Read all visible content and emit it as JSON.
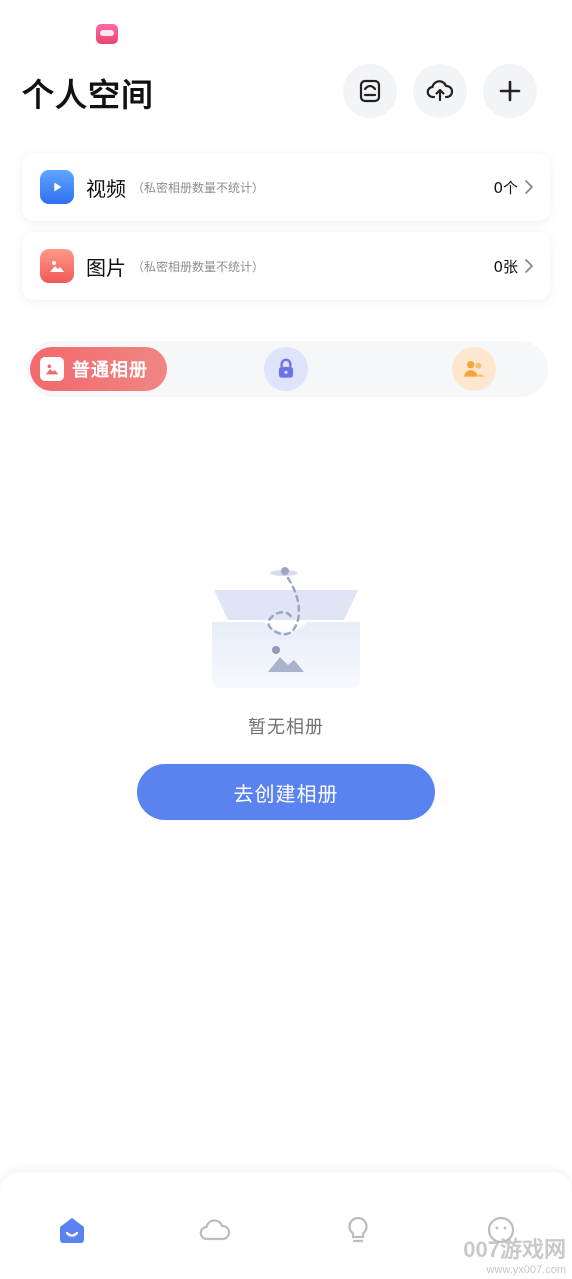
{
  "header": {
    "title": "个人空间"
  },
  "stats": [
    {
      "title": "视频",
      "note": "（私密相册数量不统计）",
      "count": "0个"
    },
    {
      "title": "图片",
      "note": "（私密相册数量不统计）",
      "count": "0张"
    }
  ],
  "album_tabs": {
    "active_label": "普通相册"
  },
  "empty_state": {
    "text": "暂无相册",
    "button_label": "去创建相册"
  },
  "watermark": {
    "main": "007游戏网",
    "url": "www.yx007.com"
  },
  "colors": {
    "primary": "#5a83f0",
    "active_tab": "#f3686c",
    "private_tab_bg": "#dfe3fb",
    "shared_tab_bg": "#fde8cf",
    "video_icon": "#3b7cf5",
    "photo_icon": "#f2675f"
  },
  "icons": {
    "header_buttons": [
      "storage-icon",
      "cloud-upload-icon",
      "plus-icon"
    ],
    "tabs": [
      "image-icon",
      "lock-icon",
      "people-icon"
    ],
    "bottom_nav": [
      "home-icon",
      "cloud-icon",
      "lightbulb-icon",
      "smiley-icon"
    ]
  }
}
